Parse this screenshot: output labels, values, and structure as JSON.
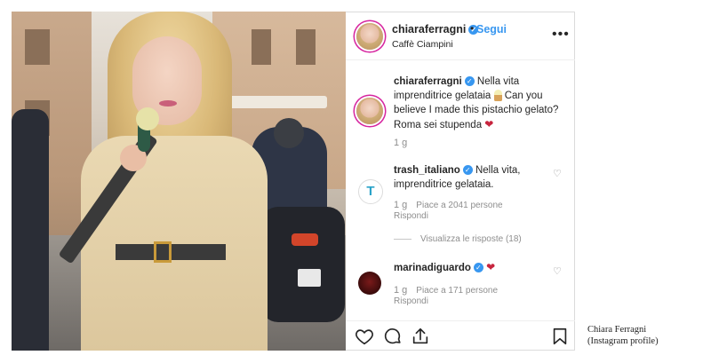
{
  "post": {
    "username": "chiaraferragni",
    "follow_label": "Segui",
    "separator": "•",
    "location": "Caffè Ciampini",
    "more_label": "•••",
    "verified_mark": "✓"
  },
  "caption": {
    "username": "chiaraferragni",
    "text_part1": "Nella vita imprenditrice gelataia",
    "text_part2": "Can you believe I made this pistachio gelato? Roma sei stupenda",
    "time": "1 g",
    "heart": "❤"
  },
  "comments": [
    {
      "username": "trash_italiano",
      "text": "Nella vita, imprenditrice gelataia.",
      "time": "1 g",
      "likes": "Piace a 2041 persone",
      "reply_label": "Rispondi",
      "avatar_glyph": "T",
      "view_replies": "Visualizza le risposte (18)"
    },
    {
      "username": "marinadiguardo",
      "text": "❤",
      "time": "1 g",
      "likes": "Piace a 171 persone",
      "reply_label": "Rispondi"
    }
  ],
  "icons": {
    "like": "heart-icon",
    "comment": "comment-icon",
    "share": "share-icon",
    "save": "bookmark-icon",
    "comment_like": "♡"
  },
  "credit": {
    "line1": "Chiara Ferragni",
    "line2": "(Instagram profile)"
  },
  "colors": {
    "link_blue": "#3897f0",
    "heart_red": "#c7253e",
    "muted_gray": "#8e8e8e"
  }
}
